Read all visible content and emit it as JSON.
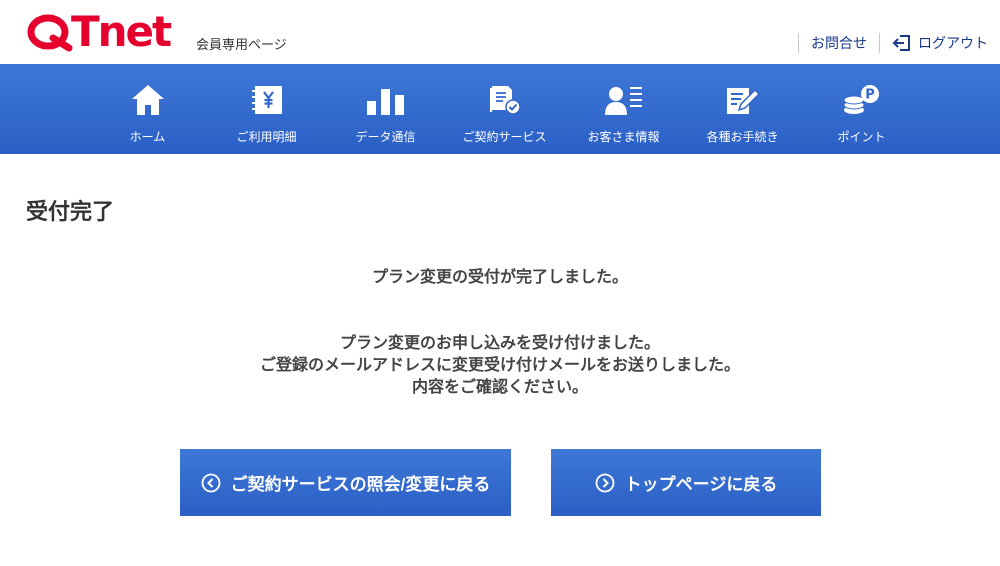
{
  "header": {
    "logo_text": "QTnet",
    "site_sub": "会員専用ページ",
    "contact_label": "お問合せ",
    "logout_label": "ログアウト"
  },
  "nav": {
    "items": [
      {
        "label": "ホーム",
        "icon": "home-icon"
      },
      {
        "label": "ご利用明細",
        "icon": "billing-icon"
      },
      {
        "label": "データ通信",
        "icon": "bar-chart-icon"
      },
      {
        "label": "ご契約サービス",
        "icon": "contract-icon"
      },
      {
        "label": "お客さま情報",
        "icon": "user-icon"
      },
      {
        "label": "各種お手続き",
        "icon": "procedure-icon"
      },
      {
        "label": "ポイント",
        "icon": "points-icon"
      }
    ]
  },
  "main": {
    "title": "受付完了",
    "message_main": "プラン変更の受付が完了しました。",
    "message_body": [
      "プラン変更のお申し込みを受け付けました。",
      "ご登録のメールアドレスに変更受け付けメールをお送りしました。",
      "内容をご確認ください。"
    ],
    "buttons": {
      "back_label": "ご契約サービスの照会/変更に戻る",
      "top_label": "トップページに戻る"
    }
  },
  "colors": {
    "brand_red": "#e5002d",
    "nav_blue": "#2b5fc6",
    "link_blue": "#1a3a8a"
  }
}
